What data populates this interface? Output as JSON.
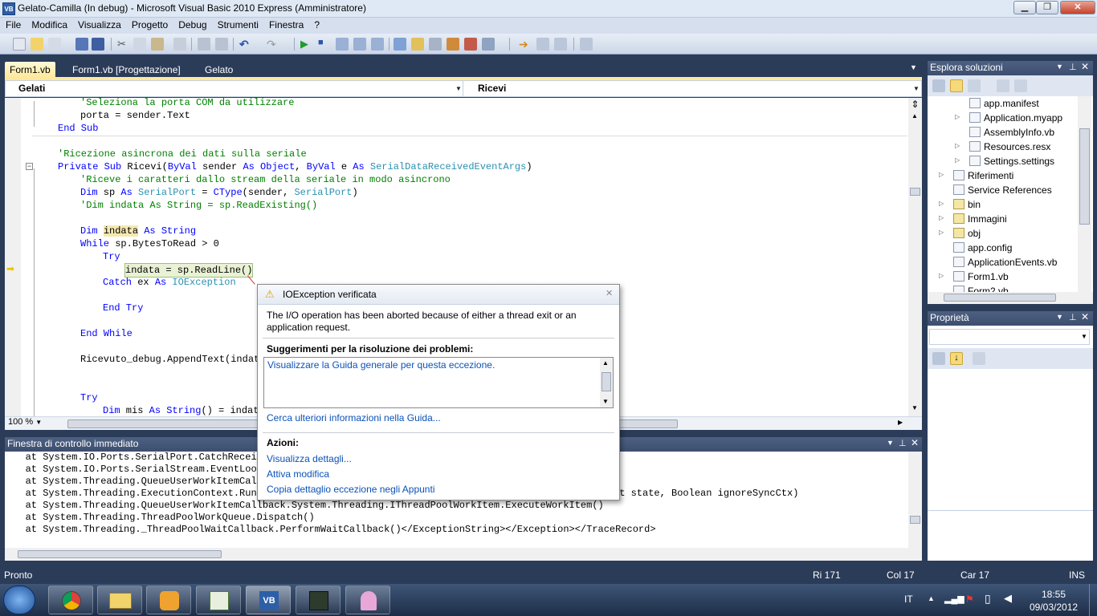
{
  "window": {
    "title": "Gelato-Camilla (In debug) - Microsoft Visual Basic 2010 Express (Amministratore)",
    "app_icon": "VB"
  },
  "menu": [
    "File",
    "Modifica",
    "Visualizza",
    "Progetto",
    "Debug",
    "Strumenti",
    "Finestra",
    "?"
  ],
  "tabs": [
    "Form1.vb",
    "Form1.vb [Progettazione]",
    "Gelato"
  ],
  "combos": {
    "left": "Gelati",
    "right": "Ricevi"
  },
  "code": {
    "l1": "'Seleziona la porta COM da utilizzare",
    "l2": "porta = sender.Text",
    "l3": "End Sub",
    "l4": "'Ricezione asincrona dei dati sulla seriale",
    "l5a": "Private Sub",
    "l5b": " Ricevi(",
    "l5c": "ByVal",
    "l5d": " sender ",
    "l5e": "As Object",
    "l5f": ", ",
    "l5g": "ByVal",
    "l5h": " e ",
    "l5i": "As",
    "l5j": " SerialDataReceivedEventArgs",
    "l5k": ")",
    "l6": "'Riceve i caratteri dallo stream della seriale in modo asincrono",
    "l7a": "Dim",
    "l7b": " sp ",
    "l7c": "As",
    "l7d": " SerialPort",
    "l7e": " = ",
    "l7f": "CType",
    "l7g": "(sender, ",
    "l7h": "SerialPort",
    "l7i": ")",
    "l8": "'Dim indata As String = sp.ReadExisting()",
    "l9a": "Dim",
    "l9b": "indata",
    "l9c": "As String",
    "l10a": "While",
    "l10b": " sp.BytesToRead > 0",
    "l11": "Try",
    "l12": "indata = sp.ReadLine()",
    "l13a": "Catch",
    "l13b": " ex ",
    "l13c": "As",
    "l13d": " IOException",
    "l14": "End Try",
    "l15": "End While",
    "l16": "Ricevuto_debug.AppendText(indata",
    "l17": "Try",
    "l18a": "Dim",
    "l18b": " mis ",
    "l18c": "As String",
    "l18d": "() = indata"
  },
  "zoom": "100 %",
  "immediate": {
    "title": "Finestra di controllo immediato",
    "lines": [
      "   at System.IO.Ports.SerialPort.CatchReceive",
      "   at System.IO.Ports.SerialStream.EventLoopR",
      "   at System.Threading.QueueUserWorkItemCallb",
      "   at System.Threading.ExecutionContext.Run(E",
      "   at System.Threading.QueueUserWorkItemCallback.System.Threading.IThreadPoolWorkItem.ExecuteWorkItem()",
      "   at System.Threading.ThreadPoolWorkQueue.Dispatch()",
      "   at System.Threading._ThreadPoolWaitCallback.PerformWaitCallback()</ExceptionString></Exception></TraceRecord>"
    ],
    "line4_tail": "ct state, Boolean ignoreSyncCtx)"
  },
  "solution": {
    "title": "Esplora soluzioni",
    "items": [
      "app.manifest",
      "Application.myapp",
      "AssemblyInfo.vb",
      "Resources.resx",
      "Settings.settings",
      "Riferimenti",
      "Service References",
      "bin",
      "Immagini",
      "obj",
      "app.config",
      "ApplicationEvents.vb",
      "Form1.vb",
      "Form2.vb"
    ]
  },
  "properties": {
    "title": "Proprietà"
  },
  "exception": {
    "title": "IOException verificata",
    "message": "The I/O operation has been aborted because of either a thread exit or an application request.",
    "tips_header": "Suggerimenti per la risoluzione dei problemi:",
    "tip": "Visualizzare la Guida generale per  questa eccezione.",
    "more_help": "Cerca ulteriori informazioni nella Guida...",
    "actions_header": "Azioni:",
    "actions": [
      "Visualizza dettagli...",
      "Attiva modifica",
      "Copia dettaglio eccezione negli Appunti"
    ]
  },
  "status": {
    "ready": "Pronto",
    "row": "Ri 171",
    "col": "Col 17",
    "car": "Car 17",
    "ins": "INS"
  },
  "taskbar": {
    "lang": "IT",
    "time": "18:55",
    "date": "09/03/2012"
  },
  "colors": {
    "accent": "#ffe89a",
    "chrome": "#2b3c59",
    "keyword": "#0000ff",
    "comment": "#008000",
    "type": "#2b91af",
    "link": "#0b52b8"
  }
}
